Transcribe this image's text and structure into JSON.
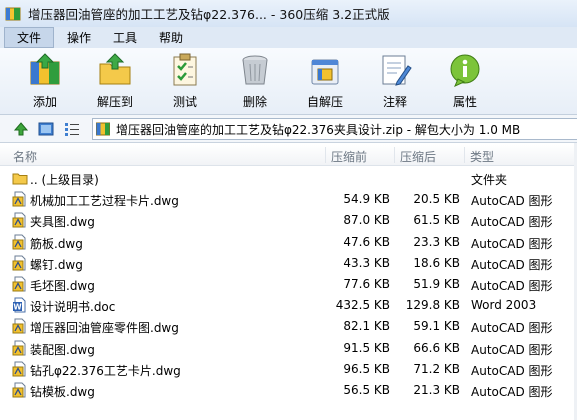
{
  "window": {
    "title": "增压器回油管座的加工工艺及钻φ22.376... - 360压缩 3.2正式版"
  },
  "menu": [
    "文件",
    "操作",
    "工具",
    "帮助"
  ],
  "toolbar": [
    {
      "label": "添加",
      "icon": "add-archive-icon"
    },
    {
      "label": "解压到",
      "icon": "extract-folder-icon"
    },
    {
      "label": "测试",
      "icon": "test-clipboard-icon"
    },
    {
      "label": "删除",
      "icon": "delete-bin-icon"
    },
    {
      "label": "自解压",
      "icon": "self-extract-icon"
    },
    {
      "label": "注释",
      "icon": "comment-note-icon"
    },
    {
      "label": "属性",
      "icon": "info-properties-icon"
    }
  ],
  "address": {
    "path": "增压器回油管座的加工工艺及钻φ22.376夹具设计.zip - 解包大小为 1.0 MB"
  },
  "columns": {
    "name": "名称",
    "original": "压缩前",
    "compressed": "压缩后",
    "type": "类型"
  },
  "files": [
    {
      "name": ".. (上级目录)",
      "original": "",
      "compressed": "",
      "type": "文件夹",
      "icon": "folder-icon"
    },
    {
      "name": "机械加工工艺过程卡片.dwg",
      "original": "54.9 KB",
      "compressed": "20.5 KB",
      "type": "AutoCAD 图形",
      "icon": "dwg-file-icon"
    },
    {
      "name": "夹具图.dwg",
      "original": "87.0 KB",
      "compressed": "61.5 KB",
      "type": "AutoCAD 图形",
      "icon": "dwg-file-icon"
    },
    {
      "name": "筋板.dwg",
      "original": "47.6 KB",
      "compressed": "23.3 KB",
      "type": "AutoCAD 图形",
      "icon": "dwg-file-icon"
    },
    {
      "name": "螺钉.dwg",
      "original": "43.3 KB",
      "compressed": "18.6 KB",
      "type": "AutoCAD 图形",
      "icon": "dwg-file-icon"
    },
    {
      "name": "毛坯图.dwg",
      "original": "77.6 KB",
      "compressed": "51.9 KB",
      "type": "AutoCAD 图形",
      "icon": "dwg-file-icon"
    },
    {
      "name": "设计说明书.doc",
      "original": "432.5 KB",
      "compressed": "129.8 KB",
      "type": "Word 2003",
      "icon": "word-doc-icon"
    },
    {
      "name": "增压器回油管座零件图.dwg",
      "original": "82.1 KB",
      "compressed": "59.1 KB",
      "type": "AutoCAD 图形",
      "icon": "dwg-file-icon"
    },
    {
      "name": "装配图.dwg",
      "original": "91.5 KB",
      "compressed": "66.6 KB",
      "type": "AutoCAD 图形",
      "icon": "dwg-file-icon"
    },
    {
      "name": "钻孔φ22.376工艺卡片.dwg",
      "original": "96.5 KB",
      "compressed": "71.2 KB",
      "type": "AutoCAD 图形",
      "icon": "dwg-file-icon"
    },
    {
      "name": "钻模板.dwg",
      "original": "56.5 KB",
      "compressed": "21.3 KB",
      "type": "AutoCAD 图形",
      "icon": "dwg-file-icon"
    }
  ]
}
